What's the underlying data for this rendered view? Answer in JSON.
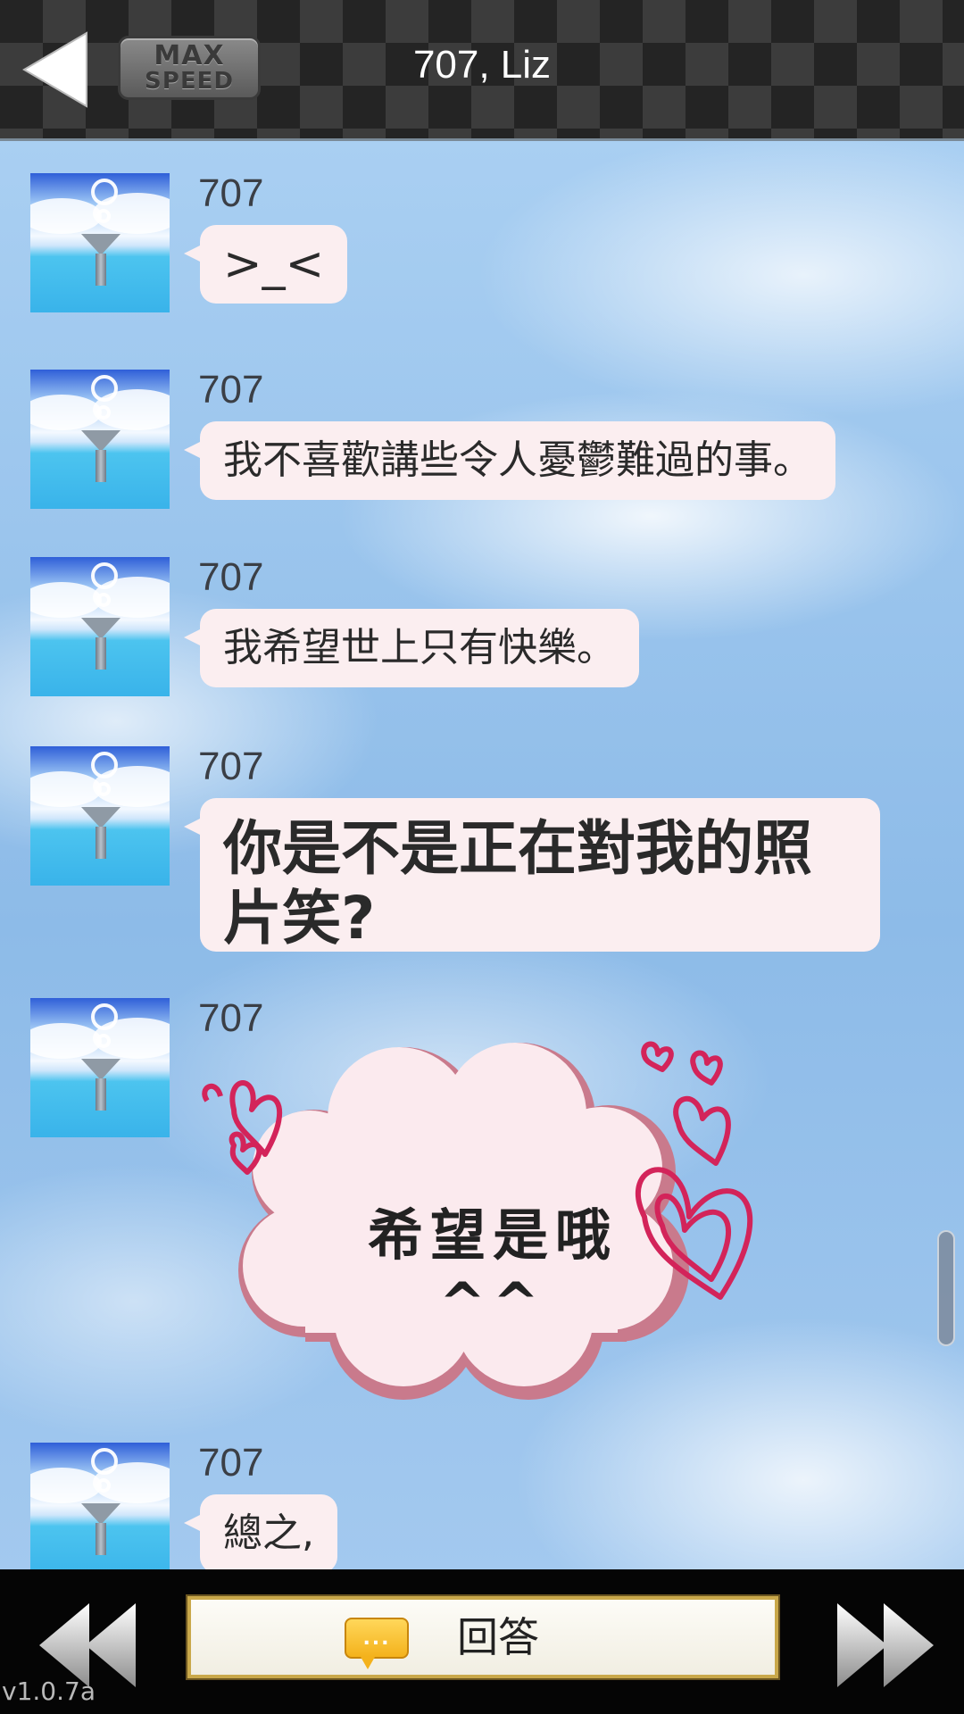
{
  "header": {
    "title": "707, Liz",
    "max_speed_line1": "MAX",
    "max_speed_line2": "SPEED",
    "back_icon": "triangle-left-icon"
  },
  "messages": [
    {
      "sender": "707",
      "text": ">_<"
    },
    {
      "sender": "707",
      "text": "我不喜歡講些令人憂鬱難過的事。"
    },
    {
      "sender": "707",
      "text": "我希望世上只有快樂。"
    },
    {
      "sender": "707",
      "text": "你是不是正在對我的照片笑?"
    },
    {
      "sender": "707",
      "sticker_text": "希望是哦 ^^"
    },
    {
      "sender": "707",
      "text": "總之,"
    }
  ],
  "footer": {
    "reply_label": "回答",
    "reply_icon_text": "...",
    "prev_icon": "rewind-icon",
    "next_icon": "fast-forward-icon",
    "version": "v1.0.7a"
  },
  "colors": {
    "bubble": "#fbeef0",
    "header_bg": "#242424",
    "reply_border": "#c9a84a",
    "heart": "#d3245a"
  }
}
